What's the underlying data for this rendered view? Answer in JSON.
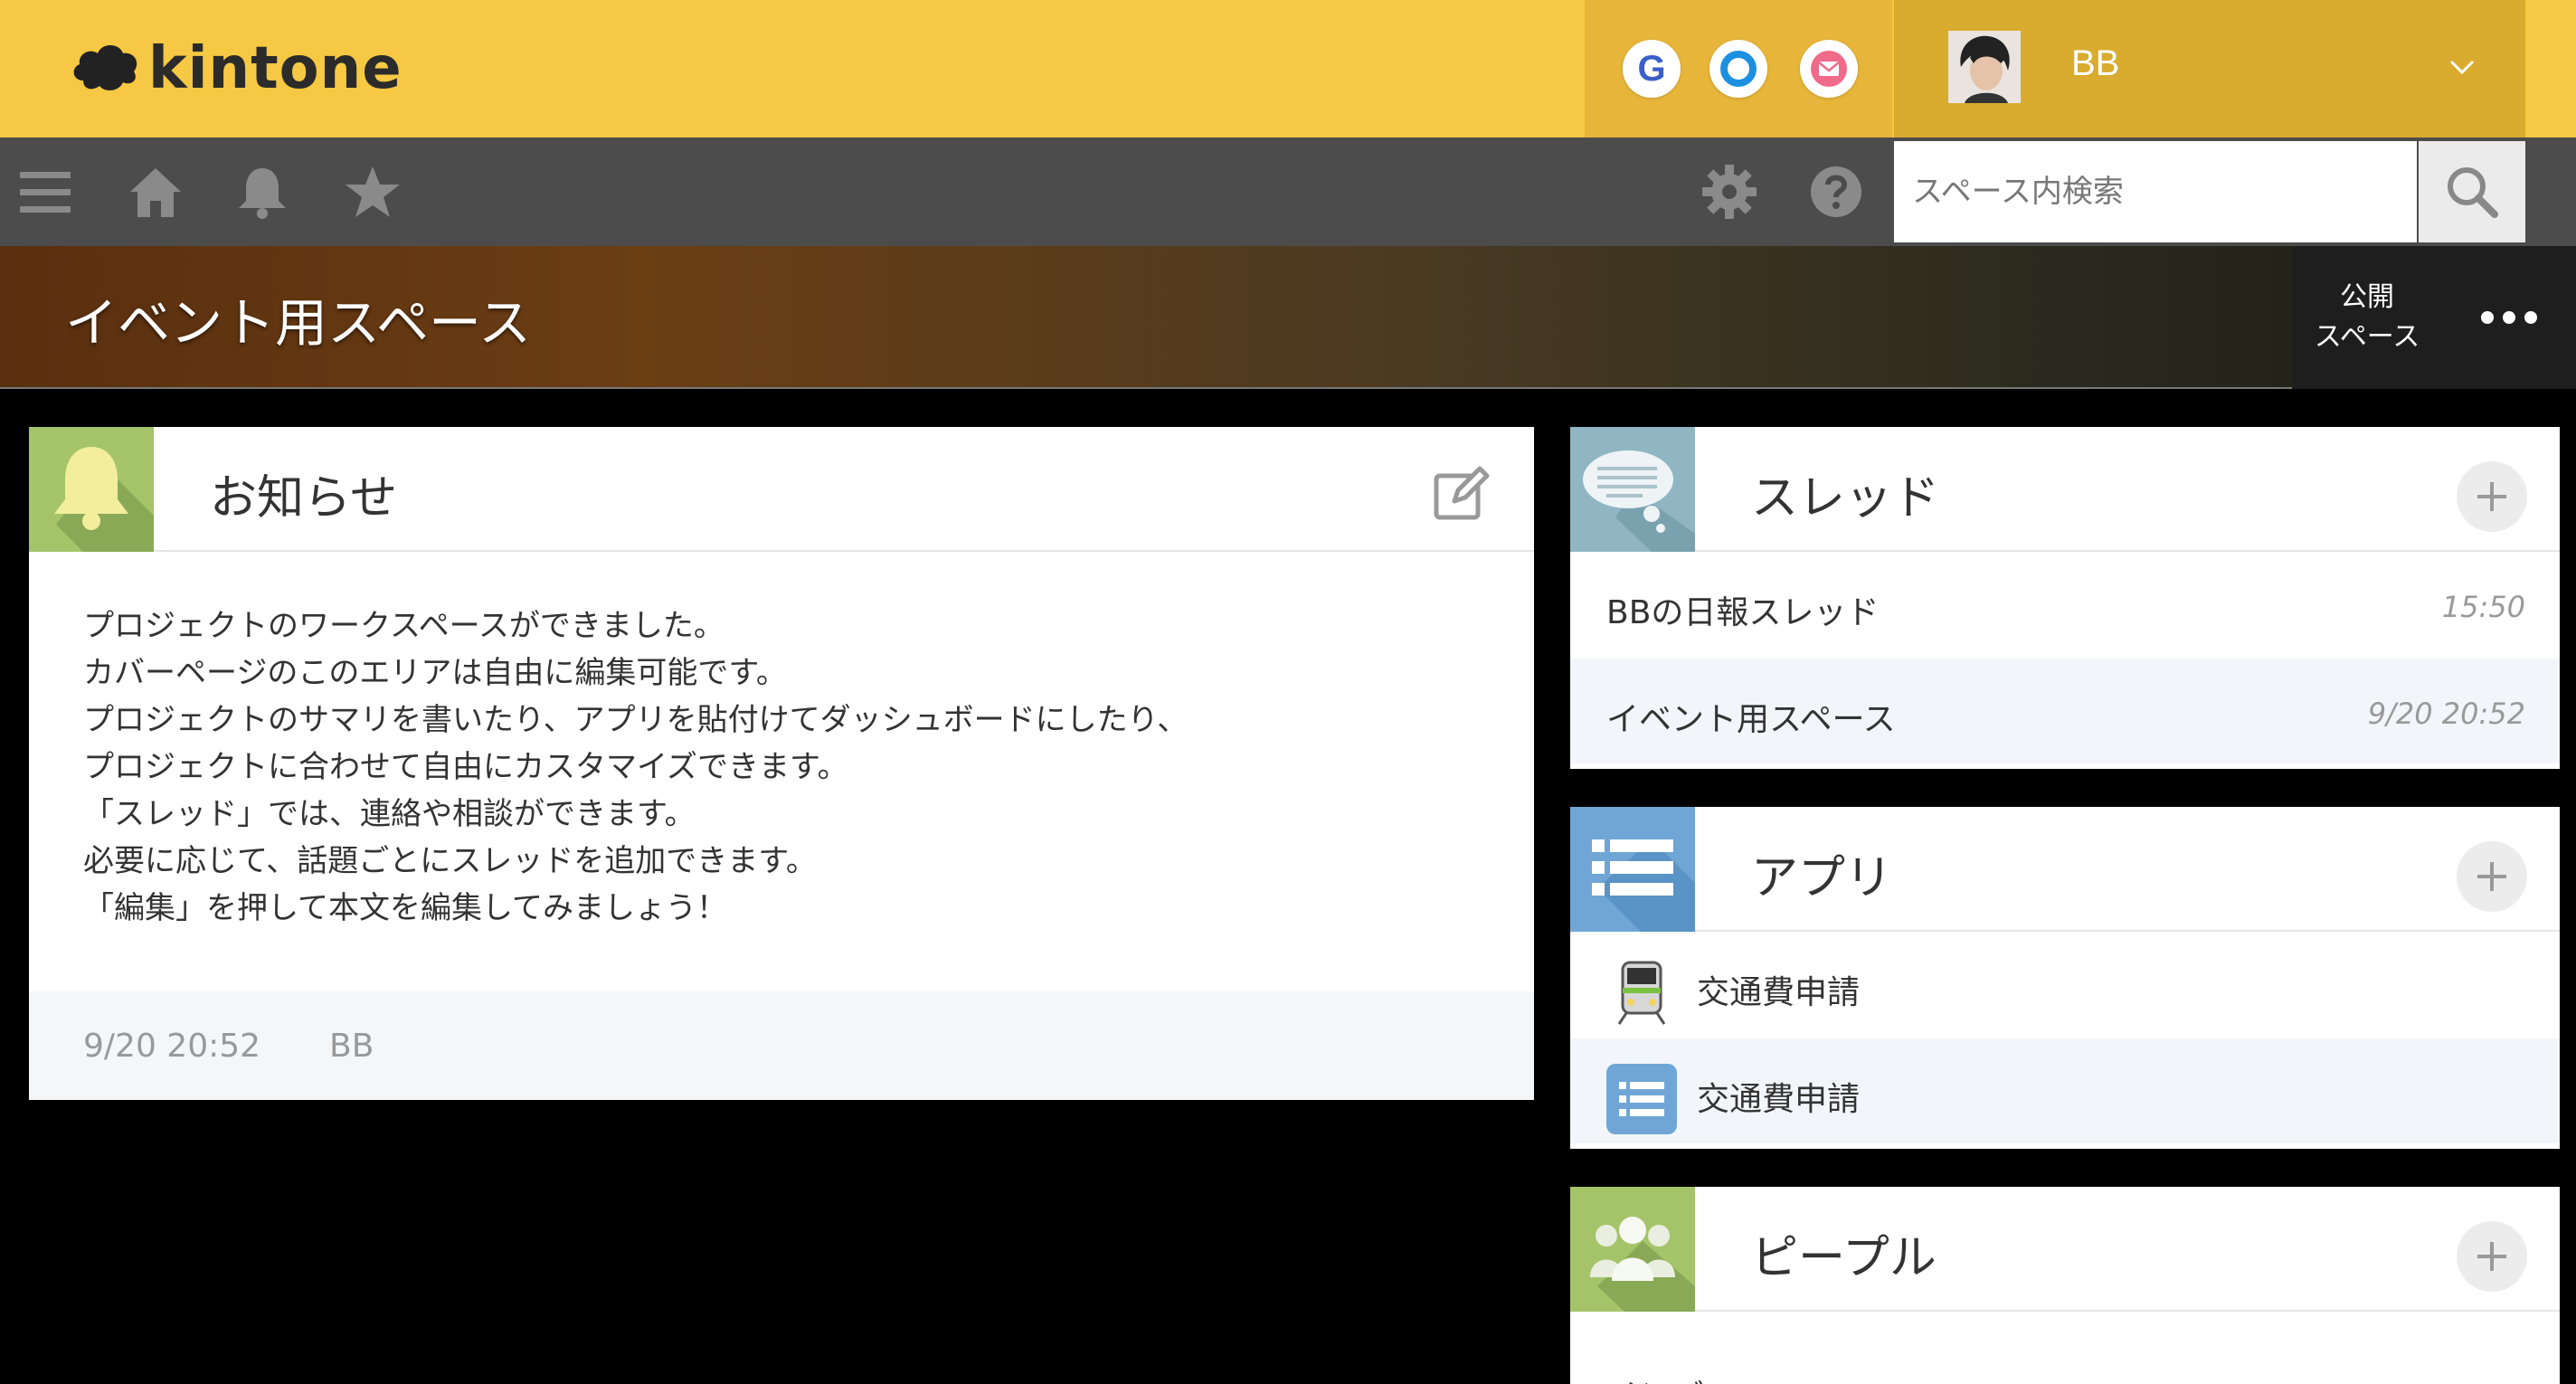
{
  "header": {
    "logo_text": "kintone",
    "user": {
      "name": "BB"
    },
    "service_icons": [
      "google-icon",
      "office-icon",
      "mail-icon"
    ]
  },
  "nav": {
    "search_placeholder": "スペース内検索"
  },
  "space": {
    "title": "イベント用スペース",
    "badge_line1": "公開",
    "badge_line2": "スペース"
  },
  "notice": {
    "title": "お知らせ",
    "lines": [
      "プロジェクトのワークスペースができました。",
      "カバーページのこのエリアは自由に編集可能です。",
      "プロジェクトのサマリを書いたり、アプリを貼付けてダッシュボードにしたり、",
      "プロジェクトに合わせて自由にカスタマイズできます。",
      "「スレッド」では、連絡や相談ができます。",
      "必要に応じて、話題ごとにスレッドを追加できます。",
      "「編集」を押して本文を編集してみましょう！"
    ],
    "footer_time": "9/20 20:52",
    "footer_user": "BB"
  },
  "threads": {
    "title": "スレッド",
    "items": [
      {
        "label": "BBの日報スレッド",
        "time": "15:50"
      },
      {
        "label": "イベント用スペース",
        "time": "9/20 20:52"
      }
    ]
  },
  "apps": {
    "title": "アプリ",
    "items": [
      {
        "label": "交通費申請",
        "icon": "train-icon"
      },
      {
        "label": "交通費申請",
        "icon": "list-icon"
      }
    ]
  },
  "people": {
    "title": "ピープル",
    "first_row": "メンバー"
  },
  "colors": {
    "header_yellow": "#f6c843",
    "navbar_gray": "#4c4c4c",
    "notice_icon_green": "#a5c46a",
    "thread_icon_teal": "#8fb6c2",
    "app_icon_blue": "#6fa6d6"
  }
}
